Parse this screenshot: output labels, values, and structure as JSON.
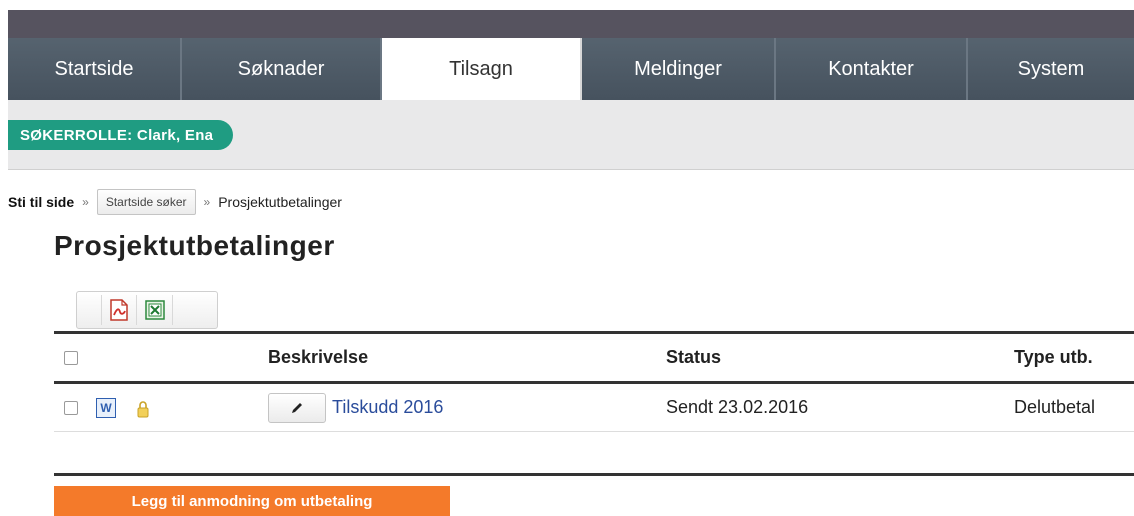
{
  "nav": {
    "tabs": [
      {
        "label": "Startside",
        "active": false
      },
      {
        "label": "Søknader",
        "active": false
      },
      {
        "label": "Tilsagn",
        "active": true
      },
      {
        "label": "Meldinger",
        "active": false
      },
      {
        "label": "Kontakter",
        "active": false
      },
      {
        "label": "System",
        "active": false
      }
    ]
  },
  "role": {
    "label": "SØKERROLLE: Clark, Ena"
  },
  "breadcrumb": {
    "label": "Sti til side",
    "separator": "»",
    "home_button": "Startside søker",
    "current": "Prosjektutbetalinger"
  },
  "page": {
    "title": "Prosjektutbetalinger"
  },
  "export": {
    "icons": [
      "pdf-icon",
      "excel-icon"
    ]
  },
  "table": {
    "headers": {
      "description": "Beskrivelse",
      "status": "Status",
      "type": "Type utb."
    },
    "rows": [
      {
        "doc_icon": "word-icon",
        "doc_label": "W",
        "lock_icon": "lock-icon",
        "description": "Tilskudd 2016",
        "status": "Sendt 23.02.2016",
        "type": "Delutbetal"
      }
    ]
  },
  "actions": {
    "add_request": "Legg til anmodning om utbetaling"
  },
  "colors": {
    "nav": "#4a5866",
    "role": "#1f9c82",
    "link": "#2a4c9b",
    "add_button": "#f47a2a"
  }
}
